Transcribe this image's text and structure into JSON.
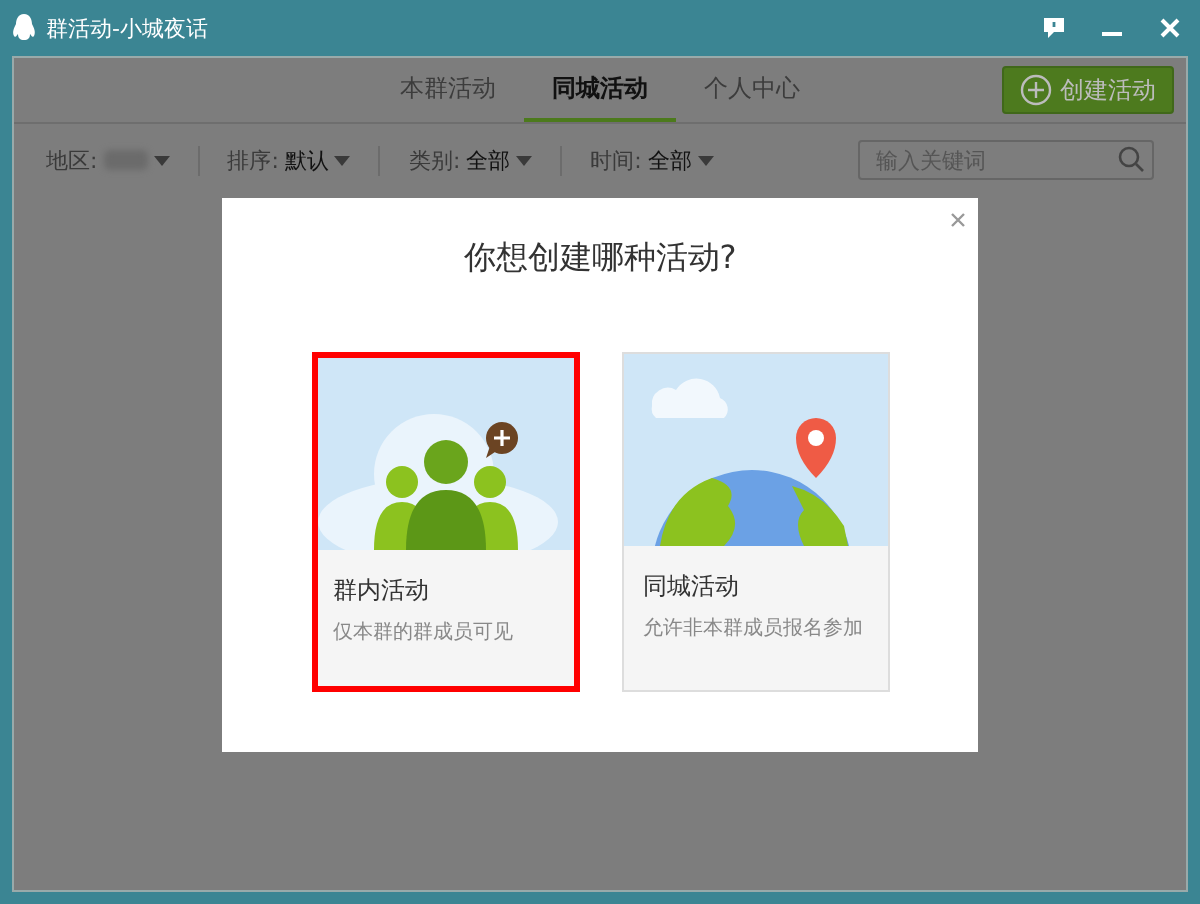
{
  "window": {
    "title": "群活动-小城夜话"
  },
  "tabs": [
    {
      "label": "本群活动",
      "selected": false
    },
    {
      "label": "同城活动",
      "selected": true
    },
    {
      "label": "个人中心",
      "selected": false
    }
  ],
  "create_button": {
    "label": "创建活动"
  },
  "filters": [
    {
      "label": "地区:",
      "blurred": true
    },
    {
      "label": "排序:",
      "value": "默认",
      "blurred": false
    },
    {
      "label": "类别:",
      "value": "全部",
      "blurred": false
    },
    {
      "label": "时间:",
      "value": "全部",
      "blurred": false
    }
  ],
  "search": {
    "placeholder": "输入关键词"
  },
  "dialog": {
    "title": "你想创建哪种活动?",
    "options": [
      {
        "kind": "group",
        "title": "群内活动",
        "subtitle": "仅本群的群成员可见",
        "selected": true
      },
      {
        "kind": "city",
        "title": "同城活动",
        "subtitle": "允许非本群成员报名参加",
        "selected": false
      }
    ]
  }
}
